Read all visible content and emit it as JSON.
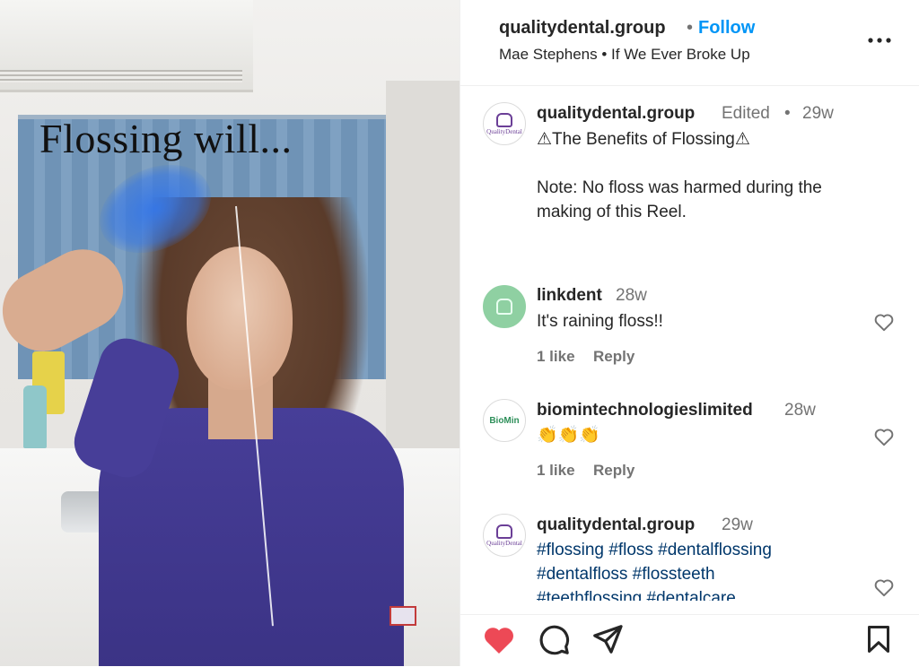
{
  "media": {
    "overlay_text": "Flossing will..."
  },
  "header": {
    "username": "qualitydental.group",
    "separator": "•",
    "follow_label": "Follow",
    "audio": "Mae Stephens • If We Ever Broke Up",
    "more_icon": "more-horizontal-icon"
  },
  "caption": {
    "username": "qualitydental.group",
    "edited": "Edited",
    "separator": "•",
    "time": "29w",
    "title": "⚠The Benefits of Flossing⚠",
    "note": "Note: No floss was harmed during the\nmaking of this Reel.",
    "avatar_text": "QualityDental"
  },
  "comments": [
    {
      "username": "linkdent",
      "time": "28w",
      "text": "It's raining floss!!",
      "likes": "1 like",
      "reply": "Reply"
    },
    {
      "username": "biomintechnologieslimited",
      "time": "28w",
      "text": "👏👏👏",
      "likes": "1 like",
      "reply": "Reply",
      "avatar_text": "BioMin"
    },
    {
      "username": "qualitydental.group",
      "time": "29w",
      "hashtags": "#flossing #floss #dentalflossing\n#dentalfloss #flossteeth\n#teethflossing #dentalcare",
      "avatar_text": "QualityDental"
    }
  ],
  "footer": {
    "like_icon": "heart-filled-icon",
    "comment_icon": "comment-icon",
    "share_icon": "share-icon",
    "save_icon": "bookmark-icon",
    "like_color": "#ed4956"
  },
  "colors": {
    "follow": "#0095f6",
    "hashtag": "#00376b",
    "muted": "#737373",
    "text": "#262626"
  }
}
